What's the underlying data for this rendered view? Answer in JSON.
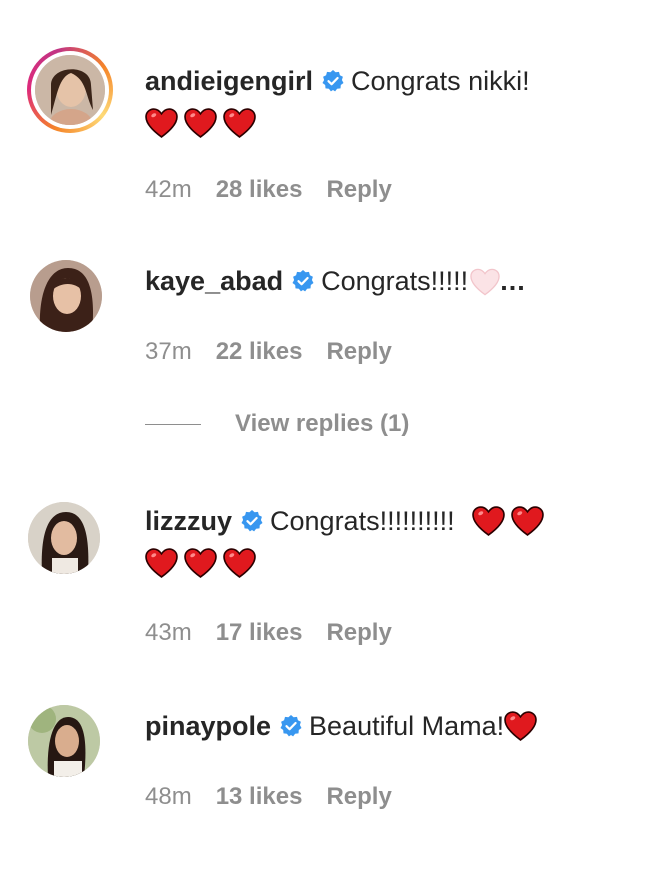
{
  "comments": [
    {
      "username": "andieigengirl",
      "text": "Congrats nikki!",
      "hearts_line2": 3,
      "time": "42m",
      "likes": "28 likes",
      "reply": "Reply",
      "has_story": true
    },
    {
      "username": "kaye_abad",
      "text": "Congrats!!!!!",
      "trailing_dots": "...",
      "time": "37m",
      "likes": "22 likes",
      "reply": "Reply",
      "view_replies": "View replies (1)"
    },
    {
      "username": "lizzzuy",
      "text": "Congrats!!!!!!!!!!",
      "hearts_line1": 2,
      "hearts_line2": 3,
      "time": "43m",
      "likes": "17 likes",
      "reply": "Reply"
    },
    {
      "username": "pinaypole",
      "text": "Beautiful Mama!",
      "time": "48m",
      "likes": "13 likes",
      "reply": "Reply"
    }
  ],
  "colors": {
    "verified": "#3897f0",
    "heart": "#e0191e",
    "meta": "#8e8e8e",
    "text": "#262626"
  },
  "icons": {
    "verified": "verified-badge-icon",
    "heart": "red-heart-emoji",
    "light_heart": "white-heart-emoji"
  }
}
